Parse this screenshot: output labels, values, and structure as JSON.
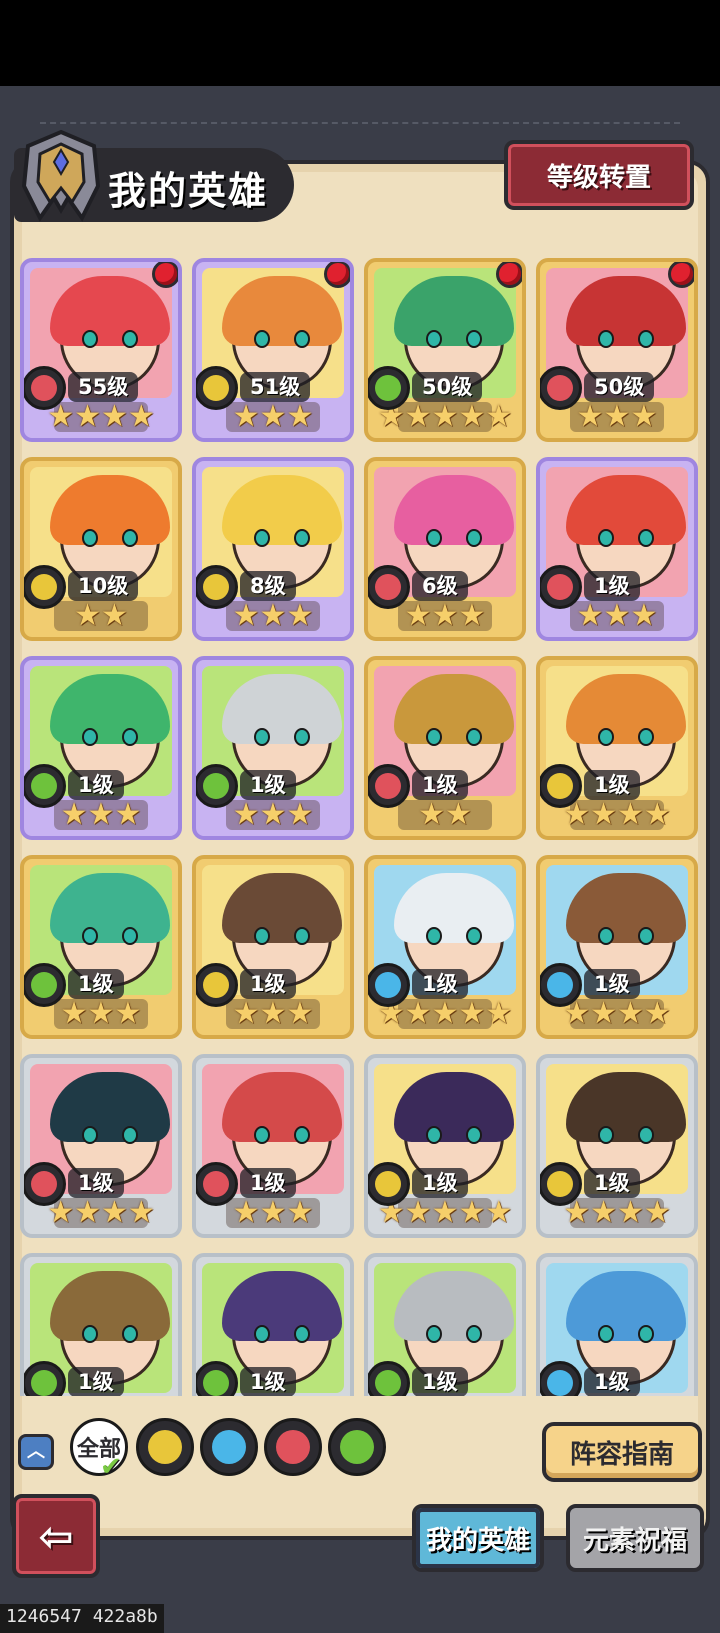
{
  "header": {
    "title": "我的英雄",
    "reset_button": "等级转置"
  },
  "colors": {
    "fire": "#e0525c",
    "earth": "#e8c63a",
    "wind": "#6ec23c",
    "water": "#4ab6e8",
    "red_dot": "#e0212f"
  },
  "heroes": [
    {
      "level": "55级",
      "stars": 4,
      "element": "fire",
      "frame": "purple",
      "badge": true,
      "hair": "#e5484f"
    },
    {
      "level": "51级",
      "stars": 3,
      "element": "earth",
      "frame": "purple",
      "badge": true,
      "hair": "#e8893c"
    },
    {
      "level": "50级",
      "stars": 5,
      "element": "wind",
      "frame": "gold",
      "badge": true,
      "hair": "#3aa36a"
    },
    {
      "level": "50级",
      "stars": 3,
      "element": "fire",
      "frame": "gold",
      "badge": true,
      "hair": "#c73434"
    },
    {
      "level": "10级",
      "stars": 2,
      "element": "earth",
      "frame": "gold",
      "badge": false,
      "hair": "#ee7b2e"
    },
    {
      "level": "8级",
      "stars": 3,
      "element": "earth",
      "frame": "purple",
      "badge": false,
      "hair": "#f2cc4a"
    },
    {
      "level": "6级",
      "stars": 3,
      "element": "fire",
      "frame": "gold",
      "badge": false,
      "hair": "#e75fa0"
    },
    {
      "level": "1级",
      "stars": 3,
      "element": "fire",
      "frame": "purple",
      "badge": false,
      "hair": "#e24a3a"
    },
    {
      "level": "1级",
      "stars": 3,
      "element": "wind",
      "frame": "purple",
      "badge": false,
      "hair": "#3fb56c"
    },
    {
      "level": "1级",
      "stars": 3,
      "element": "wind",
      "frame": "purple",
      "badge": false,
      "hair": "#cfd3d6"
    },
    {
      "level": "1级",
      "stars": 2,
      "element": "fire",
      "frame": "gold",
      "badge": false,
      "hair": "#c9983c"
    },
    {
      "level": "1级",
      "stars": 4,
      "element": "earth",
      "frame": "gold",
      "badge": false,
      "hair": "#e58a36"
    },
    {
      "level": "1级",
      "stars": 3,
      "element": "wind",
      "frame": "gold",
      "badge": false,
      "hair": "#3eb38f"
    },
    {
      "level": "1级",
      "stars": 3,
      "element": "earth",
      "frame": "gold",
      "badge": false,
      "hair": "#6a4a36"
    },
    {
      "level": "1级",
      "stars": 5,
      "element": "water",
      "frame": "gold",
      "badge": false,
      "hair": "#e9eef2"
    },
    {
      "level": "1级",
      "stars": 4,
      "element": "water",
      "frame": "gold",
      "badge": false,
      "hair": "#8a5a38"
    },
    {
      "level": "1级",
      "stars": 4,
      "element": "fire",
      "frame": "silver",
      "badge": false,
      "hair": "#1f3a46"
    },
    {
      "level": "1级",
      "stars": 3,
      "element": "fire",
      "frame": "silver",
      "badge": false,
      "hair": "#d44a4a"
    },
    {
      "level": "1级",
      "stars": 5,
      "element": "earth",
      "frame": "silver",
      "badge": false,
      "hair": "#3b2a5a"
    },
    {
      "level": "1级",
      "stars": 4,
      "element": "earth",
      "frame": "silver",
      "badge": false,
      "hair": "#4a3628"
    },
    {
      "level": "1级",
      "stars": 0,
      "element": "wind",
      "frame": "silver",
      "badge": false,
      "hair": "#8a6a3a"
    },
    {
      "level": "1级",
      "stars": 0,
      "element": "wind",
      "frame": "silver",
      "badge": false,
      "hair": "#4b3a7a"
    },
    {
      "level": "1级",
      "stars": 0,
      "element": "wind",
      "frame": "silver",
      "badge": false,
      "hair": "#b8bcc0"
    },
    {
      "level": "1级",
      "stars": 0,
      "element": "water",
      "frame": "silver",
      "badge": false,
      "hair": "#4d9ad8"
    }
  ],
  "filters": {
    "all_label": "全部",
    "elements": [
      "earth",
      "water",
      "fire",
      "wind"
    ]
  },
  "guide_button": "阵容指南",
  "tabs": {
    "my_heroes": "我的英雄",
    "element_blessing": "元素祝福"
  },
  "version_text": "1246547 422a8b"
}
